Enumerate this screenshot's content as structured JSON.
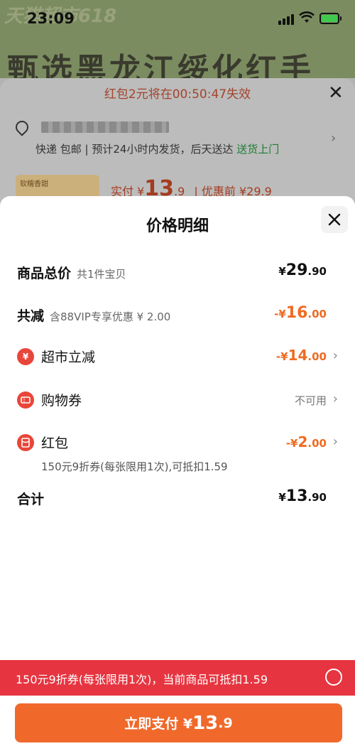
{
  "status_bar": {
    "time": "23:09"
  },
  "background": {
    "banner_brand": "天猫超市618",
    "banner_title": "甄选黑龙江绥化红手",
    "timer_text": "红包2元将在00:50:47失效",
    "shipping_prefix": "快递 包邮 | 预计24小时内发货，后天送达",
    "shipping_highlight": "送货上门",
    "price_prefix": "实付 ¥",
    "price_big": "13",
    "price_cents": ".9",
    "price_before": "| 优惠前 ¥29.9",
    "thumb_label": "软糯香甜"
  },
  "sheet": {
    "title": "价格明细",
    "rows": {
      "total": {
        "label": "商品总价",
        "sub": "共1件宝贝",
        "currency": "¥",
        "int": "29",
        "cents": ".90"
      },
      "discount": {
        "label": "共减",
        "sub": "含88VIP专享优惠 ¥ 2.00",
        "prefix": "-¥",
        "int": "16",
        "cents": ".00"
      },
      "market": {
        "label": "超市立减",
        "icon_text": "¥",
        "prefix": "-¥",
        "int": "14",
        "cents": ".00"
      },
      "coupon": {
        "label": "购物券",
        "value": "不可用"
      },
      "redpacket": {
        "label": "红包",
        "prefix": "-¥",
        "int": "2",
        "cents": ".00",
        "note": "150元9折券(每张限用1次),可抵扣1.59"
      },
      "sum": {
        "label": "合计",
        "currency": "¥",
        "int": "13",
        "cents": ".90"
      }
    }
  },
  "bottom": {
    "promo_text": "150元9折券(每张限用1次)，当前商品可抵扣1.59",
    "pay_label": "立即支付 ¥",
    "pay_int": "13",
    "pay_cents": ".9"
  },
  "colors": {
    "accent": "#f0692b",
    "discount": "#ef6b21",
    "promo_bar": "#e63540",
    "icon_red": "#e8463a"
  }
}
